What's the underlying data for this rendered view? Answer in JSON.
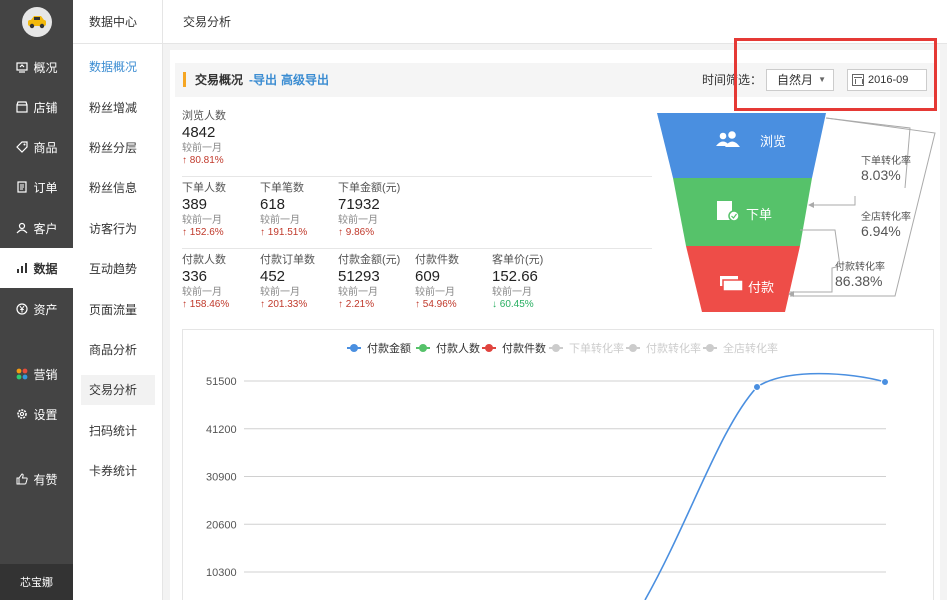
{
  "sidebar": {
    "items": [
      {
        "label": "概况",
        "icon": "overview-icon"
      },
      {
        "label": "店铺",
        "icon": "store-icon"
      },
      {
        "label": "商品",
        "icon": "tag-icon"
      },
      {
        "label": "订单",
        "icon": "order-icon"
      },
      {
        "label": "客户",
        "icon": "customer-icon"
      },
      {
        "label": "数据",
        "icon": "bar-chart-icon"
      },
      {
        "label": "资产",
        "icon": "yen-icon"
      },
      {
        "label": "营销",
        "icon": "apps-icon"
      },
      {
        "label": "设置",
        "icon": "gear-icon"
      },
      {
        "label": "有赞",
        "icon": "thumb-icon"
      }
    ],
    "footer": "芯宝娜"
  },
  "subnav": {
    "title": "数据中心",
    "items": [
      "数据概况",
      "粉丝增减",
      "粉丝分层",
      "粉丝信息",
      "访客行为",
      "互动趋势",
      "页面流量",
      "商品分析",
      "交易分析",
      "扫码统计",
      "卡券统计"
    ]
  },
  "topbar": {
    "title": "交易分析"
  },
  "overview": {
    "title": "交易概况",
    "export": "-导出",
    "advanced_export": "高级导出",
    "filter_label": "时间筛选：",
    "period": "自然月",
    "date": "2016-09"
  },
  "metrics": {
    "browse": {
      "label": "浏览人数",
      "value": "4842",
      "compare": "较前一月",
      "change": "↑ 80.81%"
    },
    "row2": [
      {
        "label": "下单人数",
        "value": "389",
        "compare": "较前一月",
        "change": "↑ 152.6%"
      },
      {
        "label": "下单笔数",
        "value": "618",
        "compare": "较前一月",
        "change": "↑ 191.51%"
      },
      {
        "label": "下单金额(元)",
        "value": "71932",
        "compare": "较前一月",
        "change": "↑ 9.86%"
      }
    ],
    "row3": [
      {
        "label": "付款人数",
        "value": "336",
        "compare": "较前一月",
        "change": "↑ 158.46%"
      },
      {
        "label": "付款订单数",
        "value": "452",
        "compare": "较前一月",
        "change": "↑ 201.33%"
      },
      {
        "label": "付款金额(元)",
        "value": "51293",
        "compare": "较前一月",
        "change": "↑ 2.21%"
      },
      {
        "label": "付款件数",
        "value": "609",
        "compare": "较前一月",
        "change": "↑ 54.96%"
      },
      {
        "label": "客单价(元)",
        "value": "152.66",
        "compare": "较前一月",
        "change": "↓ 60.45%"
      }
    ]
  },
  "funnel": {
    "stages": [
      {
        "label": "浏览",
        "color": "#4a8fe0",
        "icon": "users-icon"
      },
      {
        "label": "下单",
        "color": "#56c26a",
        "icon": "order-check-icon"
      },
      {
        "label": "付款",
        "color": "#ee4d48",
        "icon": "cards-icon"
      }
    ],
    "rates": [
      {
        "label": "下单转化率",
        "value": "8.03%"
      },
      {
        "label": "全店转化率",
        "value": "6.94%"
      },
      {
        "label": "付款转化率",
        "value": "86.38%"
      }
    ]
  },
  "chart_data": {
    "type": "line",
    "legend": [
      {
        "name": "付款金额",
        "color": "#4a8fe0",
        "active": true
      },
      {
        "name": "付款人数",
        "color": "#56c26a",
        "active": true
      },
      {
        "name": "付款件数",
        "color": "#e0443e",
        "active": true
      },
      {
        "name": "下单转化率",
        "color": "#cccccc",
        "active": false
      },
      {
        "name": "付款转化率",
        "color": "#cccccc",
        "active": false
      },
      {
        "name": "全店转化率",
        "color": "#cccccc",
        "active": false
      }
    ],
    "y_ticks": [
      51500,
      41200,
      30900,
      20600,
      10300
    ],
    "ylim": [
      0,
      51500
    ],
    "series": [
      {
        "name": "付款金额",
        "values": [
          50200,
          51293
        ]
      }
    ]
  }
}
